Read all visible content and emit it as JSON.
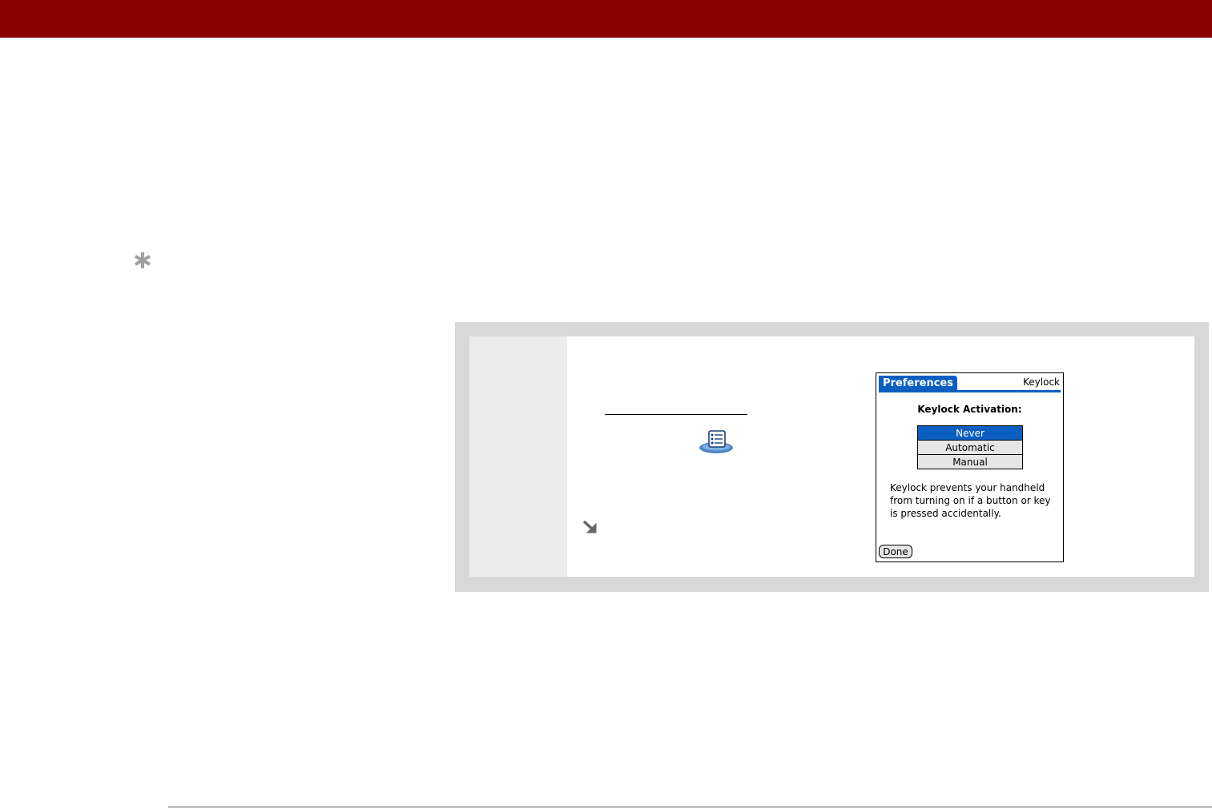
{
  "colors": {
    "header_bar": "#8b0000",
    "step_box": "#d8d8d8",
    "step_gutter": "#ececec",
    "tip_icon": "#a0a0a0",
    "palm_accent": "#0a5fc0",
    "arrow": "#666666"
  },
  "icons": {
    "tip": "asterisk-icon",
    "app": "preferences-app-icon",
    "done": "arrow-down-right-icon"
  },
  "palm_screen": {
    "title": "Preferences",
    "category": "Keylock",
    "heading": "Keylock Activation:",
    "options": [
      {
        "label": "Never",
        "selected": true
      },
      {
        "label": "Automatic",
        "selected": false
      },
      {
        "label": "Manual",
        "selected": false
      }
    ],
    "description": "Keylock prevents your handheld from turning on if a button or key is pressed accidentally.",
    "done_button": "Done"
  }
}
